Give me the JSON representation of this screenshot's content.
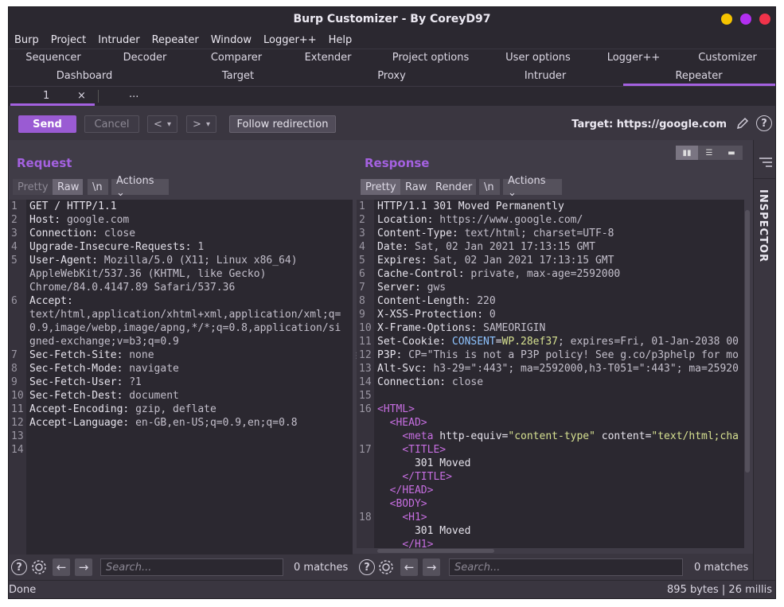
{
  "window": {
    "title": "Burp Customizer - By CoreyD97"
  },
  "colors": {
    "accent": "#a461e0",
    "send": "#9a5bd3",
    "close_yellow": "#f5c400",
    "close_purple": "#b22ff0",
    "close_red": "#f0334a"
  },
  "menu": [
    "Burp",
    "Project",
    "Intruder",
    "Repeater",
    "Window",
    "Logger++",
    "Help"
  ],
  "tabs_row1": [
    "Sequencer",
    "Decoder",
    "Comparer",
    "Extender",
    "Project options",
    "User options",
    "Logger++",
    "Customizer"
  ],
  "tabs_row2": [
    "Dashboard",
    "Target",
    "Proxy",
    "Intruder",
    "Repeater"
  ],
  "active_tab": "Repeater",
  "subtabs": {
    "first": "1",
    "close": "×",
    "more": "..."
  },
  "toolbar": {
    "send": "Send",
    "cancel": "Cancel",
    "back": "<",
    "forward": ">",
    "dropdown": "▾",
    "follow": "Follow redirection",
    "target": "Target: https://google.com",
    "help": "?"
  },
  "inspector": {
    "label": "INSPECTOR"
  },
  "request": {
    "title": "Request",
    "tabs": {
      "pretty": "Pretty",
      "raw": "Raw",
      "newline": "\\n",
      "actions": "Actions ⌄"
    },
    "lines": [
      {
        "n": "1",
        "k": "GET / HTTP/1.1",
        "v": ""
      },
      {
        "n": "2",
        "k": "Host: ",
        "v": "google.com"
      },
      {
        "n": "3",
        "k": "Connection: ",
        "v": "close"
      },
      {
        "n": "4",
        "k": "Upgrade-Insecure-Requests: ",
        "v": "1"
      },
      {
        "n": "5",
        "k": "User-Agent: ",
        "v": "Mozilla/5.0 (X11; Linux x86_64)"
      },
      {
        "n": "",
        "k": "",
        "v": "AppleWebKit/537.36 (KHTML, like Gecko)"
      },
      {
        "n": "",
        "k": "",
        "v": "Chrome/84.0.4147.89 Safari/537.36"
      },
      {
        "n": "6",
        "k": "Accept:",
        "v": ""
      },
      {
        "n": "",
        "k": "",
        "v": "text/html,application/xhtml+xml,application/xml;q="
      },
      {
        "n": "",
        "k": "",
        "v": "0.9,image/webp,image/apng,*/*;q=0.8,application/si"
      },
      {
        "n": "",
        "k": "",
        "v": "gned-exchange;v=b3;q=0.9"
      },
      {
        "n": "7",
        "k": "Sec-Fetch-Site: ",
        "v": "none"
      },
      {
        "n": "8",
        "k": "Sec-Fetch-Mode: ",
        "v": "navigate"
      },
      {
        "n": "9",
        "k": "Sec-Fetch-User: ",
        "v": "?1"
      },
      {
        "n": "10",
        "k": "Sec-Fetch-Dest: ",
        "v": "document"
      },
      {
        "n": "11",
        "k": "Accept-Encoding: ",
        "v": "gzip, deflate"
      },
      {
        "n": "12",
        "k": "Accept-Language: ",
        "v": "en-GB,en-US;q=0.9,en;q=0.8"
      },
      {
        "n": "13",
        "k": "",
        "v": ""
      },
      {
        "n": "14",
        "k": "",
        "v": ""
      }
    ],
    "search_placeholder": "Search...",
    "matches": "0 matches"
  },
  "response": {
    "title": "Response",
    "tabs": {
      "pretty": "Pretty",
      "raw": "Raw",
      "render": "Render",
      "newline": "\\n",
      "actions": "Actions ⌄"
    },
    "lines": [
      {
        "n": "1",
        "k": "HTTP/1.1 301 Moved Permanently",
        "v": ""
      },
      {
        "n": "2",
        "k": "Location: ",
        "v": "https://www.google.com/"
      },
      {
        "n": "3",
        "k": "Content-Type: ",
        "v": "text/html; charset=UTF-8"
      },
      {
        "n": "4",
        "k": "Date: ",
        "v": "Sat, 02 Jan 2021 17:13:15 GMT"
      },
      {
        "n": "5",
        "k": "Expires: ",
        "v": "Sat, 02 Jan 2021 17:13:15 GMT"
      },
      {
        "n": "6",
        "k": "Cache-Control: ",
        "v": "private, max-age=2592000"
      },
      {
        "n": "7",
        "k": "Server: ",
        "v": "gws"
      },
      {
        "n": "8",
        "k": "Content-Length: ",
        "v": "220"
      },
      {
        "n": "9",
        "k": "X-XSS-Protection: ",
        "v": "0"
      },
      {
        "n": "10",
        "k": "X-Frame-Options: ",
        "v": "SAMEORIGIN"
      },
      {
        "n": "11",
        "k": "Set-Cookie: ",
        "cookie_name": "CONSENT",
        "cookie_eq": "=",
        "cookie_val": "WP.28ef37",
        "v": "; expires=Fri, 01-Jan-2038 00"
      },
      {
        "n": "12",
        "k": "P3P: ",
        "v": "CP=\"This is not a P3P policy! See g.co/p3phelp for mo"
      },
      {
        "n": "13",
        "k": "Alt-Svc: ",
        "v": "h3-29=\":443\"; ma=2592000,h3-T051=\":443\"; ma=25920"
      },
      {
        "n": "14",
        "k": "Connection: ",
        "v": "close"
      },
      {
        "n": "15",
        "k": "",
        "v": ""
      }
    ],
    "html_lines": [
      {
        "n": "16",
        "indent": "",
        "open": "<",
        "tag": "HTML",
        "close": ">"
      },
      {
        "n": "",
        "indent": "  ",
        "open": "<",
        "tag": "HEAD",
        "close": ">"
      },
      {
        "n": "",
        "indent": "    ",
        "open": "<",
        "tag": "meta",
        "attr1": " http-equiv=",
        "val1": "\"content-type\"",
        "attr2": " content=",
        "val2": "\"text/html;cha"
      },
      {
        "n": "17",
        "indent": "    ",
        "open": "<",
        "tag": "TITLE",
        "close": ">"
      },
      {
        "n": "",
        "indent": "      ",
        "text": "301 Moved"
      },
      {
        "n": "",
        "indent": "    ",
        "open": "</",
        "tag": "TITLE",
        "close": ">"
      },
      {
        "n": "",
        "indent": "  ",
        "open": "</",
        "tag": "HEAD",
        "close": ">"
      },
      {
        "n": "",
        "indent": "  ",
        "open": "<",
        "tag": "BODY",
        "close": ">"
      },
      {
        "n": "18",
        "indent": "    ",
        "open": "<",
        "tag": "H1",
        "close": ">"
      },
      {
        "n": "",
        "indent": "      ",
        "text": "301 Moved"
      },
      {
        "n": "",
        "indent": "    ",
        "open": "</",
        "tag": "H1",
        "close": ">"
      }
    ],
    "search_placeholder": "Search...",
    "matches": "0 matches"
  },
  "status": {
    "left": "Done",
    "right": "895 bytes | 26 millis"
  }
}
